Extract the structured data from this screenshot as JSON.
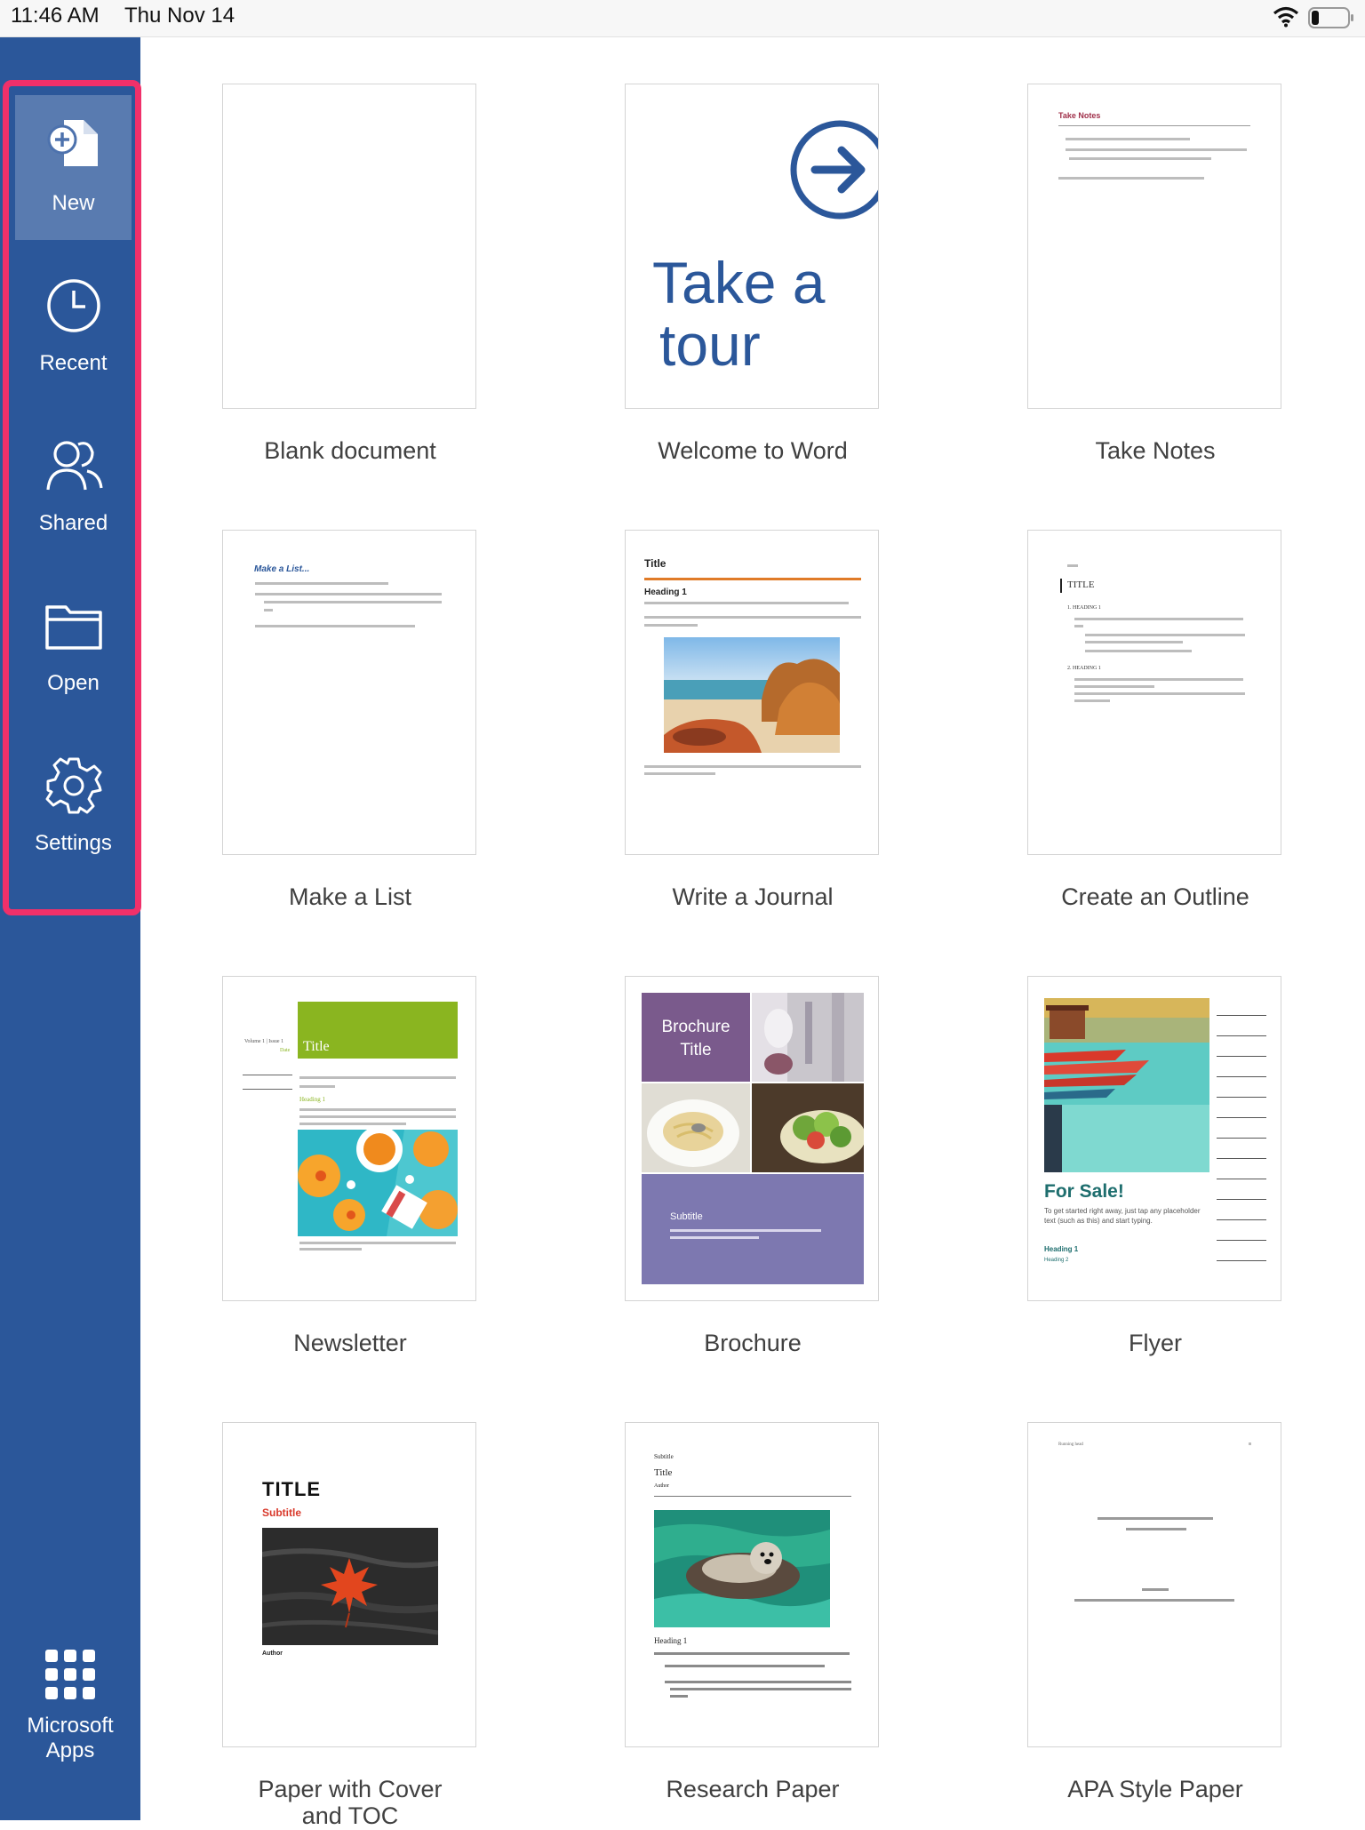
{
  "status_bar": {
    "time": "11:46 AM",
    "date": "Thu Nov 14"
  },
  "sidebar": {
    "items": [
      {
        "label": "New",
        "icon": "new-document-icon",
        "selected": true
      },
      {
        "label": "Recent",
        "icon": "clock-icon"
      },
      {
        "label": "Shared",
        "icon": "people-icon"
      },
      {
        "label": "Open",
        "icon": "folder-icon"
      },
      {
        "label": "Settings",
        "icon": "gear-icon"
      }
    ],
    "apps": {
      "label_line1": "Microsoft",
      "label_line2": "Apps",
      "icon": "app-grid-icon"
    }
  },
  "templates": [
    {
      "label": "Blank document"
    },
    {
      "label": "Welcome to Word",
      "thumb_line1": "Take a",
      "thumb_line2": "tour"
    },
    {
      "label": "Take Notes",
      "thumb_heading": "Take Notes"
    },
    {
      "label": "Make a List",
      "thumb_heading": "Make a List..."
    },
    {
      "label": "Write a Journal",
      "thumb_title": "Title",
      "thumb_heading": "Heading 1"
    },
    {
      "label": "Create an Outline",
      "thumb_title": "TITLE",
      "thumb_h1": "1. HEADING 1",
      "thumb_h2": "2. HEADING 1"
    },
    {
      "label": "Newsletter",
      "thumb_title": "Title",
      "thumb_heading": "Heading 1",
      "thumb_meta": "Volume 1 | Issue 1",
      "thumb_date": "Date"
    },
    {
      "label": "Brochure",
      "thumb_title_line1": "Brochure",
      "thumb_title_line2": "Title",
      "thumb_subtitle": "Subtitle"
    },
    {
      "label": "Flyer",
      "thumb_heading": "For Sale!",
      "thumb_body": "To get started right away, just tap any placeholder text (such as this) and start typing.",
      "thumb_h1": "Heading 1",
      "thumb_h2": "Heading 2"
    },
    {
      "label_line1": "Paper with Cover",
      "label_line2": "and TOC",
      "thumb_title": "TITLE",
      "thumb_subtitle": "Subtitle",
      "thumb_author": "Author"
    },
    {
      "label": "Research Paper",
      "thumb_subtitle": "Subtitle",
      "thumb_title": "Title",
      "thumb_author": "Author",
      "thumb_heading": "Heading 1"
    },
    {
      "label": "APA Style Paper",
      "thumb_running": "Running head"
    }
  ],
  "colors": {
    "sidebar": "#2b579a",
    "highlight": "#f0306a",
    "word_blue": "#2b579a",
    "journal_rule": "#e07b28",
    "newsletter_green": "#8ab520",
    "brochure_purple": "#7a5a8c",
    "brochure_lavender": "#7d78b0",
    "flyer_teal": "#1e6e6e"
  }
}
